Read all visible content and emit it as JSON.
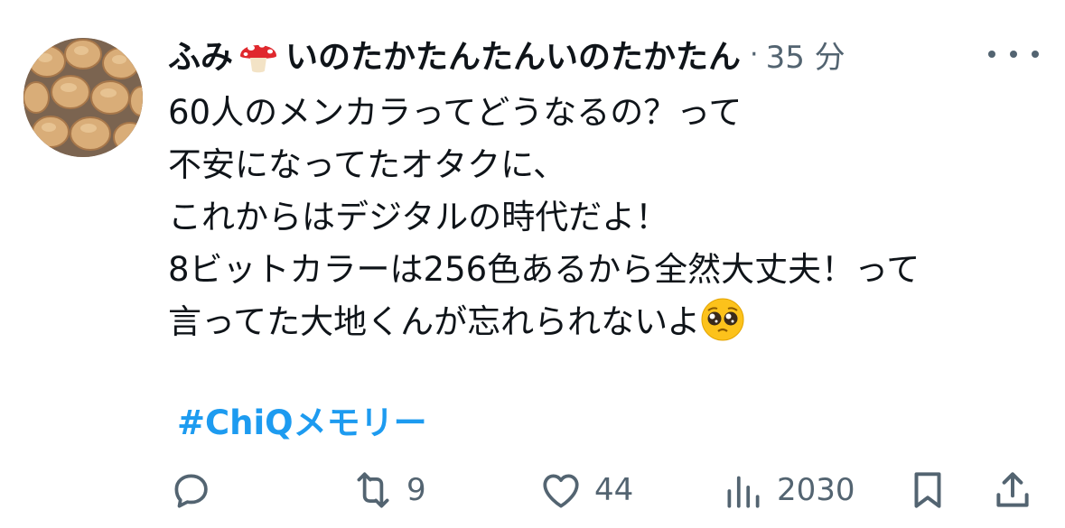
{
  "tweet": {
    "display_name_part1": "ふみ",
    "display_name_part2": "いのたかたんたんいのたかたん",
    "separator": "·",
    "time": "35 分",
    "lines": [
      "60人のメンカラってどうなるの？って",
      "不安になってたオタクに、",
      "これからはデジタルの時代だよ！",
      "8ビットカラーは256色あるから全然大丈夫！って",
      "言ってた大地くんが忘れられないよ"
    ],
    "hashtag": "#ChiQメモリー"
  },
  "actions": {
    "reply_count": "",
    "retweet_count": "9",
    "like_count": "44",
    "views_count": "2030"
  },
  "icons": {
    "name_emoji": "mushroom-icon",
    "line_emoji": "pleading-face-icon",
    "reply": "reply-icon",
    "retweet": "retweet-icon",
    "like": "heart-icon",
    "views": "views-icon",
    "bookmark": "bookmark-icon",
    "share": "share-icon",
    "more": "more-icon"
  },
  "colors": {
    "text": "#0f1419",
    "secondary": "#536471",
    "link": "#1d9bf0"
  }
}
